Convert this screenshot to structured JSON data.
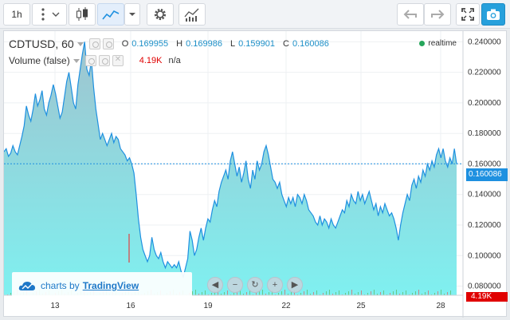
{
  "toolbar": {
    "interval_label": "1h",
    "buttons": [
      "interval-selector",
      "more-menu",
      "candles-style",
      "area-style",
      "style-dropdown",
      "settings",
      "indicators",
      "undo",
      "redo",
      "fullscreen",
      "snapshot"
    ]
  },
  "legend": {
    "symbol": "CDTUSD, 60",
    "open_key": "O",
    "open": "0.169955",
    "high_key": "H",
    "high": "0.169986",
    "low_key": "L",
    "low": "0.159901",
    "close_key": "C",
    "close": "0.160086",
    "volume_label": "Volume (false)",
    "volume_value": "4.19K",
    "volume_na": "n/a"
  },
  "realtime_label": "realtime",
  "last_price_tag": "0.160086",
  "volume_tag": "4.19K",
  "watermark": {
    "prefix": "charts by",
    "brand": "TradingView"
  },
  "colors": {
    "line": "#1e90e0",
    "area_top": "#9fc4cf",
    "area_bottom": "#7ff0f0",
    "price_tag": "#1e90e0",
    "volume_tag": "#e00000",
    "realtime_dot": "#26a65b"
  },
  "chart_data": {
    "type": "area",
    "x_ticks": [
      "13",
      "16",
      "19",
      "22",
      "25",
      "28"
    ],
    "y_ticks": [
      "0.240000",
      "0.220000",
      "0.200000",
      "0.180000",
      "0.160000",
      "0.140000",
      "0.120000",
      "0.100000",
      "0.080000"
    ],
    "ylim": [
      0.074,
      0.247
    ],
    "last_price": 0.160086,
    "grid": true,
    "series": [
      {
        "values": [
          0.168,
          0.17,
          0.165,
          0.167,
          0.172,
          0.168,
          0.166,
          0.172,
          0.178,
          0.185,
          0.198,
          0.192,
          0.188,
          0.196,
          0.206,
          0.198,
          0.202,
          0.208,
          0.196,
          0.192,
          0.2,
          0.205,
          0.212,
          0.206,
          0.198,
          0.19,
          0.194,
          0.204,
          0.214,
          0.22,
          0.21,
          0.2,
          0.196,
          0.212,
          0.222,
          0.232,
          0.24,
          0.222,
          0.218,
          0.228,
          0.21,
          0.196,
          0.186,
          0.176,
          0.18,
          0.176,
          0.172,
          0.176,
          0.18,
          0.174,
          0.178,
          0.176,
          0.17,
          0.168,
          0.166,
          0.162,
          0.164,
          0.16,
          0.154,
          0.14,
          0.124,
          0.112,
          0.104,
          0.1,
          0.096,
          0.1,
          0.112,
          0.104,
          0.1,
          0.098,
          0.102,
          0.096,
          0.092,
          0.096,
          0.094,
          0.092,
          0.094,
          0.092,
          0.096,
          0.09,
          0.086,
          0.092,
          0.098,
          0.116,
          0.11,
          0.1,
          0.104,
          0.112,
          0.118,
          0.11,
          0.118,
          0.124,
          0.122,
          0.13,
          0.136,
          0.132,
          0.142,
          0.148,
          0.152,
          0.156,
          0.15,
          0.162,
          0.168,
          0.16,
          0.152,
          0.158,
          0.148,
          0.154,
          0.162,
          0.15,
          0.144,
          0.156,
          0.15,
          0.162,
          0.156,
          0.16,
          0.168,
          0.172,
          0.166,
          0.158,
          0.15,
          0.148,
          0.144,
          0.148,
          0.14,
          0.136,
          0.132,
          0.138,
          0.134,
          0.138,
          0.132,
          0.14,
          0.138,
          0.134,
          0.14,
          0.136,
          0.13,
          0.128,
          0.126,
          0.122,
          0.12,
          0.126,
          0.12,
          0.124,
          0.122,
          0.118,
          0.124,
          0.12,
          0.118,
          0.122,
          0.126,
          0.13,
          0.128,
          0.136,
          0.132,
          0.14,
          0.136,
          0.134,
          0.142,
          0.136,
          0.14,
          0.134,
          0.138,
          0.142,
          0.136,
          0.13,
          0.134,
          0.126,
          0.132,
          0.128,
          0.134,
          0.13,
          0.126,
          0.128,
          0.124,
          0.118,
          0.11,
          0.12,
          0.128,
          0.134,
          0.14,
          0.136,
          0.146,
          0.15,
          0.144,
          0.152,
          0.148,
          0.156,
          0.152,
          0.16,
          0.156,
          0.162,
          0.158,
          0.166,
          0.17,
          0.164,
          0.17,
          0.162,
          0.158,
          0.164,
          0.16,
          0.17,
          0.16
        ]
      }
    ]
  }
}
